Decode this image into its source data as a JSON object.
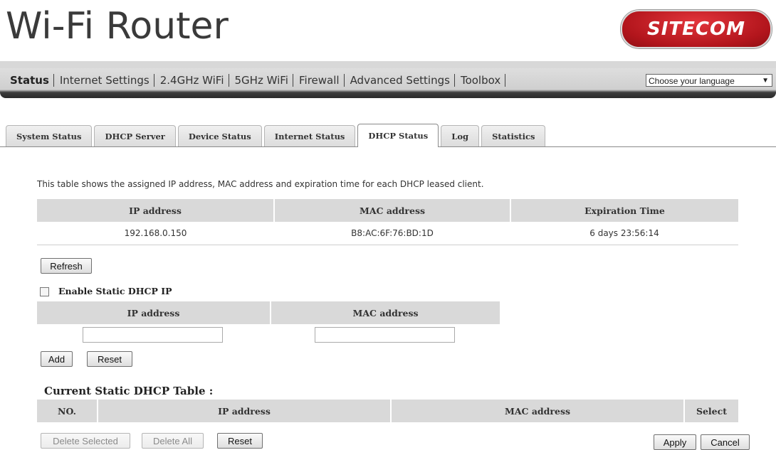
{
  "app_title": "Wi-Fi Router",
  "logo_text": "SITECOM",
  "nav": {
    "items": [
      "Status",
      "Internet Settings",
      "2.4GHz WiFi",
      "5GHz WiFi",
      "Firewall",
      "Advanced Settings",
      "Toolbox"
    ],
    "language_select": "Choose your language"
  },
  "tabs": [
    "System Status",
    "DHCP Server",
    "Device Status",
    "Internet Status",
    "DHCP Status",
    "Log",
    "Statistics"
  ],
  "active_tab": "DHCP Status",
  "description": "This table shows the assigned IP address, MAC address and expiration time for each DHCP leased client.",
  "leases": {
    "headers": [
      "IP address",
      "MAC address",
      "Expiration Time"
    ],
    "rows": [
      [
        "192.168.0.150",
        "B8:AC:6F:76:BD:1D",
        "6 days 23:56:14"
      ]
    ]
  },
  "refresh_label": "Refresh",
  "static": {
    "enable_label": "Enable Static DHCP IP",
    "enabled": false,
    "headers": [
      "IP address",
      "MAC address"
    ],
    "ip_value": "",
    "mac_value": "",
    "add_label": "Add",
    "reset_label": "Reset"
  },
  "current_table": {
    "title": "Current Static DHCP Table :",
    "headers": [
      "NO.",
      "IP address",
      "MAC address",
      "Select"
    ]
  },
  "footer": {
    "delete_selected": "Delete Selected",
    "delete_all": "Delete All",
    "reset": "Reset",
    "apply": "Apply",
    "cancel": "Cancel"
  },
  "colors": {
    "brand_red": "#c0191f",
    "nav_dark": "#2a2a2a",
    "header_gray": "#d9d9d9"
  }
}
